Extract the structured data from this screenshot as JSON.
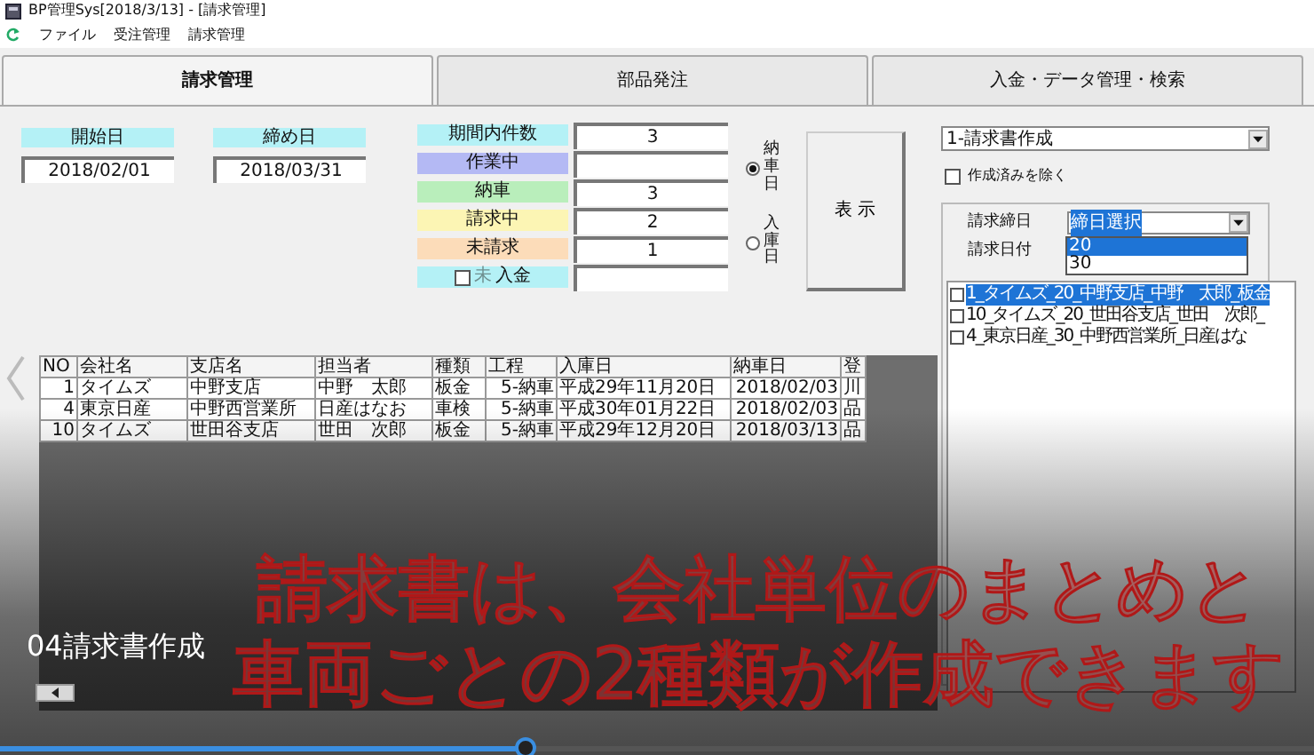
{
  "window": {
    "title": "BP管理Sys[2018/3/13] - [請求管理]"
  },
  "menu": [
    {
      "label": "ファイル"
    },
    {
      "label": "受注管理"
    },
    {
      "label": "請求管理"
    }
  ],
  "tabs": [
    {
      "label": "請求管理",
      "selected": true
    },
    {
      "label": "部品発注",
      "selected": false
    },
    {
      "label": "入金・データ管理・検索",
      "selected": false
    }
  ],
  "period": {
    "start_label": "開始日",
    "start": "2018/02/01",
    "end_label": "締め日",
    "end": "2018/03/31"
  },
  "status_counts": [
    {
      "kind": "plain",
      "label": "期間内件数",
      "color": "#b4f1f6",
      "value": "3"
    },
    {
      "kind": "plain",
      "label": "作業中",
      "color": "#b4b9f4"
    },
    {
      "kind": "plain",
      "label": "納車",
      "color": "#b9eebb",
      "value": "3"
    },
    {
      "kind": "plain",
      "label": "請求中",
      "color": "#fcf5b4",
      "value": "2"
    },
    {
      "kind": "plain",
      "label": "未請求",
      "color": "#fcdcb9",
      "value": "1"
    },
    {
      "kind": "checkbox",
      "label": "入金",
      "color": "#b4f1f6",
      "prefix": "未",
      "checked": false
    }
  ],
  "date_basis": [
    {
      "label": "納車日",
      "selected": true
    },
    {
      "label": "入庫日",
      "selected": false
    }
  ],
  "show_button": "表 示",
  "table": {
    "columns": [
      "NO",
      "会社名",
      "支店名",
      "担当者",
      "種類",
      "工程",
      "入庫日",
      "納車日",
      "登"
    ],
    "rows": [
      {
        "cells": [
          "1",
          "タイムズ",
          "中野支店",
          "中野　太郎",
          "板金",
          "5-納車",
          "平成29年11月20日",
          "2018/02/03",
          "川"
        ]
      },
      {
        "cells": [
          "4",
          "東京日産",
          "中野西営業所",
          "日産はなお",
          "車検",
          "5-納車",
          "平成30年01月22日",
          "2018/02/03",
          "品"
        ]
      },
      {
        "cells": [
          "10",
          "タイムズ",
          "世田谷支店",
          "世田　次郎",
          "板金",
          "5-納車",
          "平成29年12月20日",
          "2018/03/13",
          "品"
        ]
      }
    ]
  },
  "mode_select": {
    "value": "1-請求書作成"
  },
  "exclude_done": {
    "label": "作成済みを除く",
    "checked": false
  },
  "closing_day": {
    "label": "請求締日",
    "value": "締日選択",
    "options": [
      {
        "label": "20",
        "selected": true
      },
      {
        "label": "30",
        "selected": false
      }
    ]
  },
  "invoice_date": {
    "label": "請求日付"
  },
  "invoice_list": [
    {
      "label": "1_タイムズ_20_中野支店_中野　太郎_板金",
      "checked": false,
      "selected": true
    },
    {
      "label": "10_タイムズ_20_世田谷支店_世田　次郎_",
      "checked": false,
      "selected": false
    },
    {
      "label": "4_東京日産_30_中野西営業所_日産はな",
      "checked": false,
      "selected": false
    }
  ],
  "video": {
    "chapter": "04請求書作成",
    "subtitle": [
      "請求書は、会社単位のまとめと",
      "車両ごとの2種類が作成できます"
    ],
    "progress": {
      "level": 0.4
    }
  }
}
